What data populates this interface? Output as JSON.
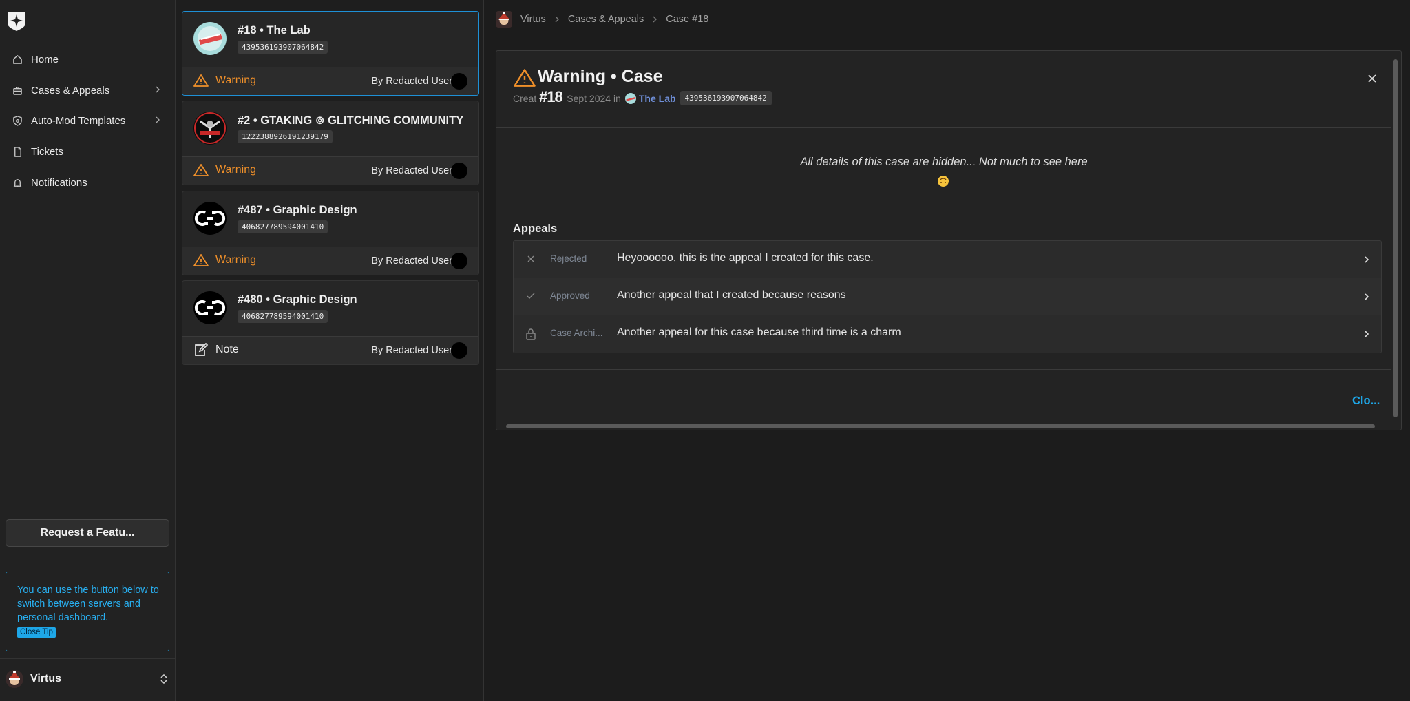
{
  "sidebar": {
    "nav": [
      {
        "label": "Home",
        "icon": "home-icon"
      },
      {
        "label": "Cases & Appeals",
        "icon": "briefcase-icon"
      },
      {
        "label": "Auto-Mod Templates",
        "icon": "shield-icon"
      },
      {
        "label": "Tickets",
        "icon": "ticket-icon"
      },
      {
        "label": "Notifications",
        "icon": "bell-icon"
      }
    ],
    "feature_button": "Request a Featu...",
    "tip": {
      "text": "You can use the button below to switch between servers and personal dashboard.",
      "close": "Close Tip"
    },
    "server": "Virtus"
  },
  "cases": [
    {
      "title": "#18 • The Lab",
      "id": "439536193907064842",
      "type": "Warning",
      "by": "By Redacted User"
    },
    {
      "title": "#2 • GTAKING ⊚ GLITCHING COMMUNITY",
      "id": "1222388926191239179",
      "type": "Warning",
      "by": "By Redacted User"
    },
    {
      "title": "#487 • Graphic Design",
      "id": "406827789594001410",
      "type": "Warning",
      "by": "By Redacted User"
    },
    {
      "title": "#480 • Graphic Design",
      "id": "406827789594001410",
      "type": "Note",
      "by": "By Redacted User"
    }
  ],
  "breadcrumb": [
    "Virtus",
    "Cases & Appeals",
    "Case #18"
  ],
  "case_panel": {
    "title": "Warning • Case",
    "overlay_number": "#18",
    "created_prefix": "Creat",
    "created_suffix": "Sept 2024 in",
    "server_name": "The Lab",
    "server_id": "439536193907064842",
    "hidden_message": "All details of this case are hidden... Not much to see here",
    "appeals_heading": "Appeals",
    "appeals": [
      {
        "status": "Rejected",
        "text": "Heyoooooo, this is the appeal I created for this case.",
        "icon": "x-icon"
      },
      {
        "status": "Approved",
        "text": "Another appeal that I created because reasons",
        "icon": "check-icon"
      },
      {
        "status": "Case Archi...",
        "text": "Another appeal for this case because third time is a charm",
        "icon": "lock-icon"
      }
    ],
    "close_label": "Clo..."
  },
  "colors": {
    "accent": "#1ea7e8",
    "warning": "#f0902a",
    "server_link": "#6f8fd8"
  }
}
